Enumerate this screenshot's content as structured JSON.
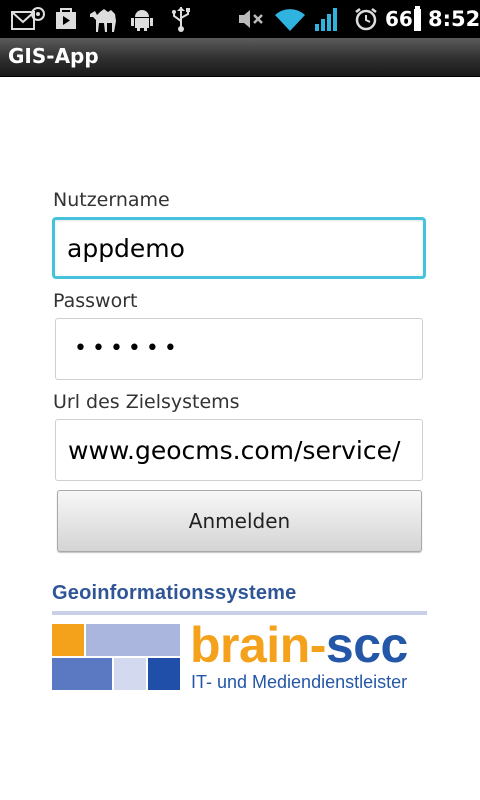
{
  "status_bar": {
    "battery": "66",
    "time": "8:52",
    "icons": [
      "email-notification-icon",
      "play-store-icon",
      "camel-icon",
      "android-debug-icon",
      "usb-icon",
      "mute-icon",
      "wifi-icon",
      "signal-icon",
      "alarm-icon",
      "battery-icon"
    ]
  },
  "title_bar": {
    "title": "GIS-App"
  },
  "form": {
    "username_label": "Nutzername",
    "username_value": "appdemo",
    "password_label": "Passwort",
    "password_dots": "••••••",
    "url_label": "Url des Zielsystems",
    "url_value": "www.geocms.com/service/",
    "login_button": "Anmelden"
  },
  "logo": {
    "caption": "Geoinformationssysteme",
    "brand_part1": "brain-",
    "brand_part2": "scc",
    "tagline": "IT- und Mediendienstleister",
    "colors": {
      "orange": "#f4a11c",
      "blue": "#2457a8",
      "light_blue": "#aab6dd",
      "pale_blue": "#d3d9ee"
    }
  }
}
